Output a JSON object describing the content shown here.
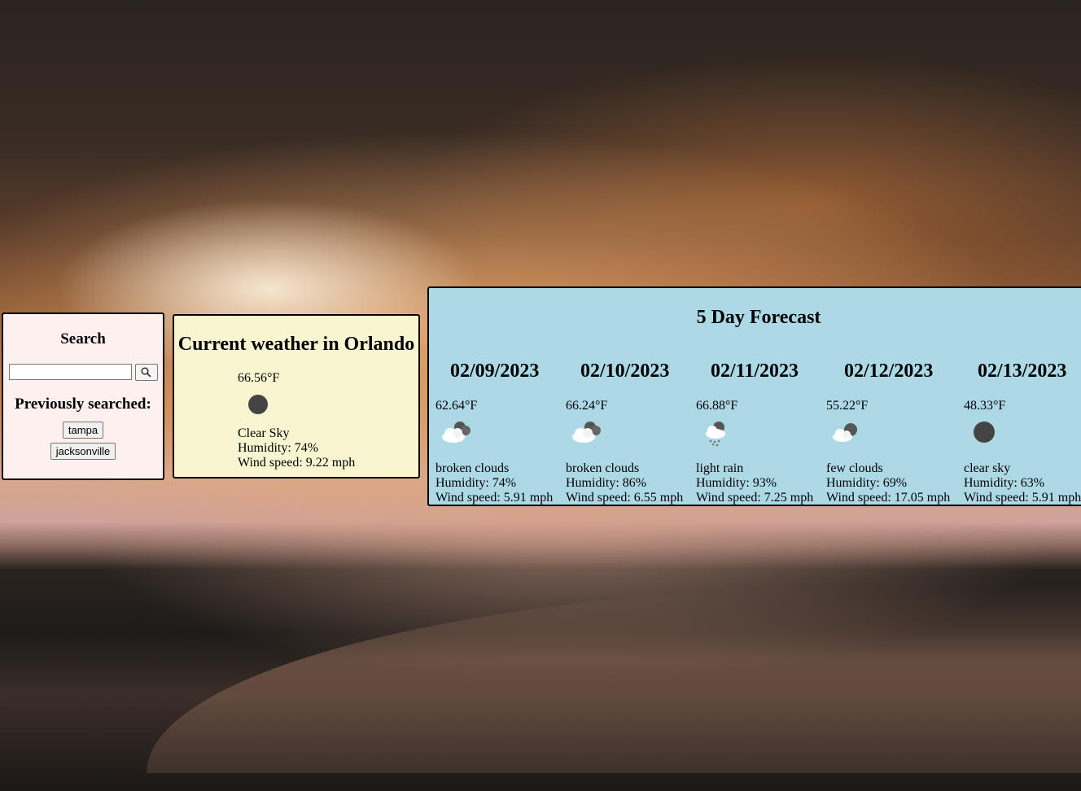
{
  "search": {
    "heading": "Search",
    "input_value": "",
    "search_icon": "magnifier-icon",
    "history_heading": "Previously searched:",
    "history": [
      "tampa",
      "jacksonville"
    ]
  },
  "current": {
    "title": "Current weather in Orlando",
    "temp": "66.56°F",
    "icon": "clear-night-icon",
    "desc": "Clear Sky",
    "humidity": "Humidity: 74%",
    "wind": "Wind speed: 9.22 mph"
  },
  "forecast": {
    "title": "5 Day Forecast",
    "days": [
      {
        "date": "02/09/2023",
        "temp": "62.64°F",
        "icon": "broken-clouds-icon",
        "desc": "broken clouds",
        "humidity": "Humidity: 74%",
        "wind": "Wind speed: 5.91 mph"
      },
      {
        "date": "02/10/2023",
        "temp": "66.24°F",
        "icon": "broken-clouds-icon",
        "desc": "broken clouds",
        "humidity": "Humidity: 86%",
        "wind": "Wind speed: 6.55 mph"
      },
      {
        "date": "02/11/2023",
        "temp": "66.88°F",
        "icon": "light-rain-icon",
        "desc": "light rain",
        "humidity": "Humidity: 93%",
        "wind": "Wind speed: 7.25 mph"
      },
      {
        "date": "02/12/2023",
        "temp": "55.22°F",
        "icon": "few-clouds-icon",
        "desc": "few clouds",
        "humidity": "Humidity: 69%",
        "wind": "Wind speed: 17.05 mph"
      },
      {
        "date": "02/13/2023",
        "temp": "48.33°F",
        "icon": "clear-night-icon",
        "desc": "clear sky",
        "humidity": "Humidity: 63%",
        "wind": "Wind speed: 5.91 mph"
      }
    ]
  },
  "colors": {
    "search_bg": "#fff0f0",
    "current_bg": "#f8f5d0",
    "forecast_bg": "#add8e6"
  }
}
